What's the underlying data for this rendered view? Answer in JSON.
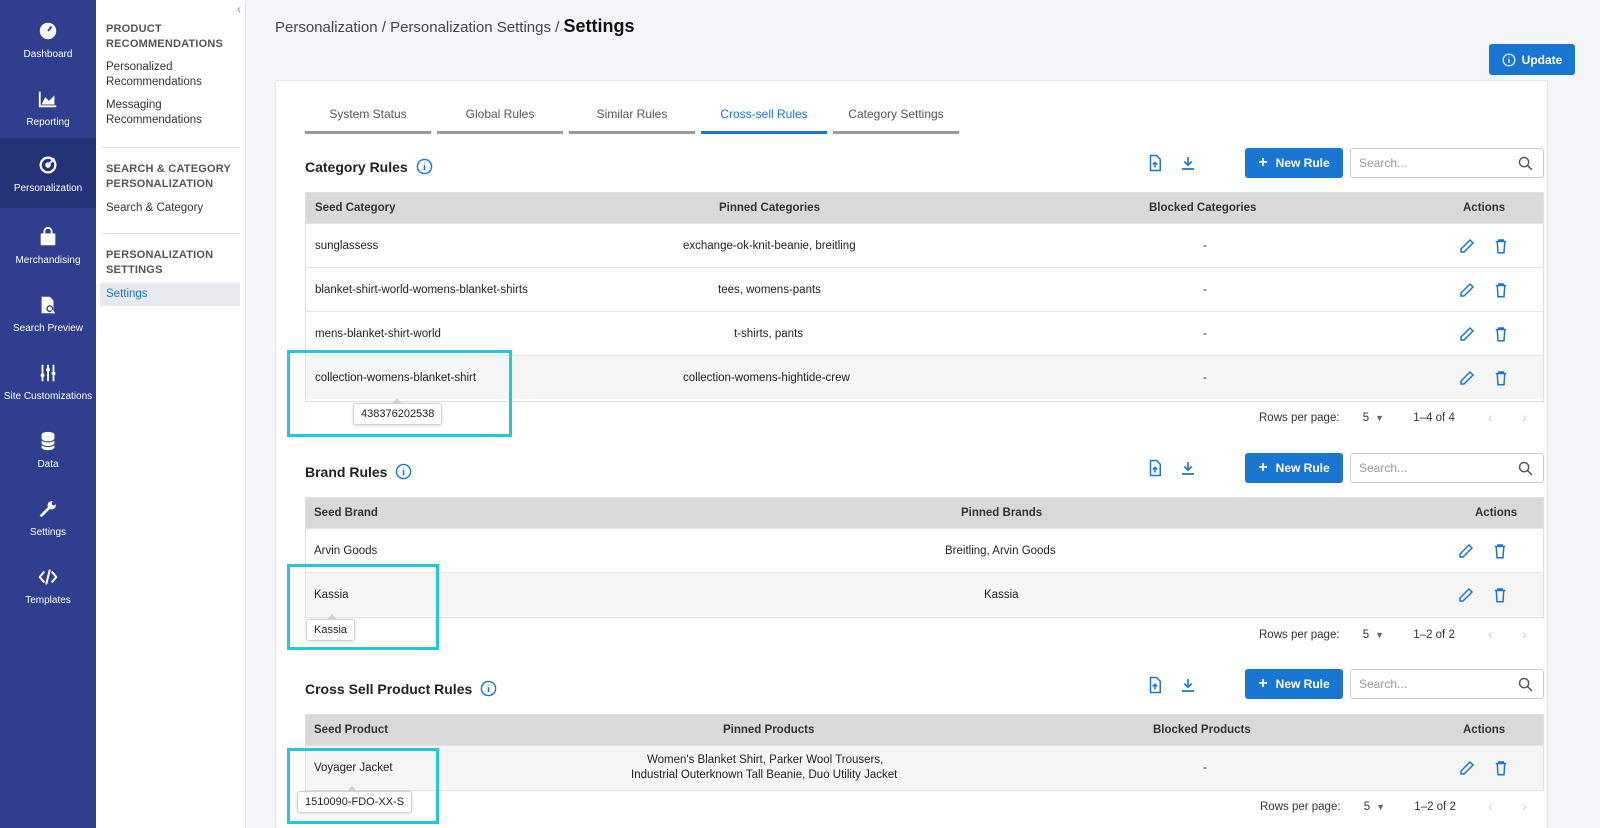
{
  "colors": {
    "rail_bg": "#2f3e8f",
    "rail_active": "#243278",
    "accent": "#1976d2",
    "highlight_box": "#22c7d9"
  },
  "rail": [
    {
      "label": "Dashboard",
      "icon": "dashboard-gauge-icon"
    },
    {
      "label": "Reporting",
      "icon": "area-chart-icon"
    },
    {
      "label": "Personalization",
      "icon": "personalization-target-icon",
      "active": true
    },
    {
      "label": "Merchandising",
      "icon": "shopping-bag-icon"
    },
    {
      "label": "Search Preview",
      "icon": "search-document-icon"
    },
    {
      "label": "Site Customizations",
      "icon": "sliders-icon"
    },
    {
      "label": "Data",
      "icon": "database-icon"
    },
    {
      "label": "Settings",
      "icon": "wrench-icon"
    },
    {
      "label": "Templates",
      "icon": "code-brackets-icon"
    }
  ],
  "subnav": {
    "collapse_glyph": "‹",
    "sections": [
      {
        "heading": "PRODUCT RECOMMENDATIONS",
        "links": [
          "Personalized Recommendations",
          "Messaging Recommendations"
        ]
      },
      {
        "heading": "SEARCH & CATEGORY PERSONALIZATION",
        "links": [
          "Search & Category"
        ]
      },
      {
        "heading": "PERSONALIZATION SETTINGS",
        "links": [
          "Settings"
        ]
      }
    ]
  },
  "breadcrumb": {
    "path": "Personalization / Personalization Settings / ",
    "current": "Settings"
  },
  "update_button": "Update",
  "tabs": [
    "System Status",
    "Global Rules",
    "Similar Rules",
    "Cross-sell Rules",
    "Category Settings"
  ],
  "active_tab": "Cross-sell Rules",
  "new_rule_label": "New Rule",
  "search_placeholder": "Search...",
  "rows_per_page_label": "Rows per page:",
  "category_rules": {
    "title": "Category Rules",
    "columns": [
      "Seed Category",
      "Pinned Categories",
      "Blocked Categories",
      "Actions"
    ],
    "rows": [
      [
        "sunglassess",
        "exchange-ok-knit-beanie, breitling",
        "-"
      ],
      [
        "blanket-shirt-world-womens-blanket-shirts",
        "tees, womens-pants",
        "-"
      ],
      [
        "mens-blanket-shirt-world",
        "t-shirts, pants",
        "-"
      ],
      [
        "collection-womens-blanket-shirt",
        "collection-womens-hightide-crew",
        "-"
      ]
    ],
    "tooltip": "438376202538",
    "rows_per_page": "5",
    "range": "1–4 of 4"
  },
  "brand_rules": {
    "title": "Brand Rules",
    "columns": [
      "Seed Brand",
      "Pinned Brands",
      "Actions"
    ],
    "rows": [
      [
        "Arvin Goods",
        "Breitling, Arvin Goods"
      ],
      [
        "Kassia",
        "Kassia"
      ]
    ],
    "tooltip": "Kassia",
    "rows_per_page": "5",
    "range": "1–2 of 2"
  },
  "product_rules": {
    "title": "Cross Sell Product Rules",
    "columns": [
      "Seed Product",
      "Pinned Products",
      "Blocked Products",
      "Actions"
    ],
    "rows": [
      [
        "Voyager Jacket",
        "Women's Blanket Shirt, Parker Wool Trousers,",
        "Industrial Outerknown Tall Beanie, Duo Utility Jacket",
        "-"
      ]
    ],
    "tooltip": "1510090-FDO-XX-S",
    "rows_per_page": "5",
    "range": "1–2 of 2"
  }
}
